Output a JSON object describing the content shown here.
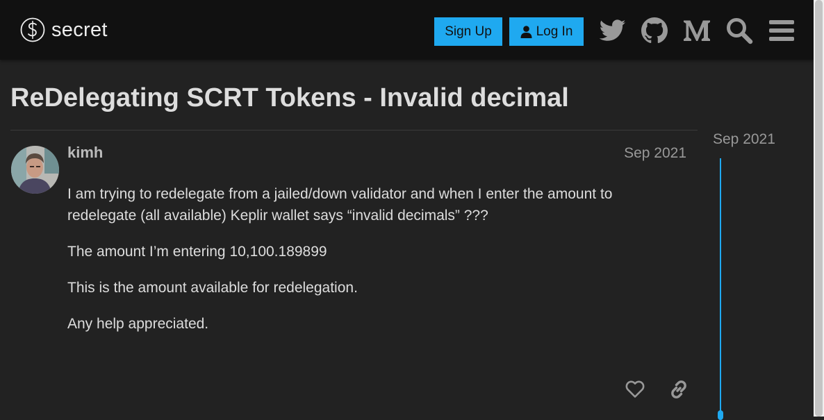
{
  "header": {
    "logo_text": "secret",
    "signup_label": "Sign Up",
    "login_label": "Log In",
    "icons": [
      "twitter-icon",
      "github-icon",
      "medium-icon",
      "search-icon",
      "hamburger-menu-icon"
    ]
  },
  "topic": {
    "title": "ReDelegating SCRT Tokens - Invalid decimal"
  },
  "post": {
    "username": "kimh",
    "date": "Sep 2021",
    "paragraphs": [
      "I am trying to redelegate from a jailed/down validator and when I enter the amount to redelegate (all available) Keplir wallet says “invalid decimals” ???",
      "The amount I’m entering 10,100.189899",
      "This is the amount available for redelegation.",
      "Any help appreciated."
    ]
  },
  "timeline": {
    "date": "Sep 2021"
  },
  "colors": {
    "accent": "#1fa9f0",
    "header_bg": "#111111",
    "page_bg": "#222222"
  }
}
